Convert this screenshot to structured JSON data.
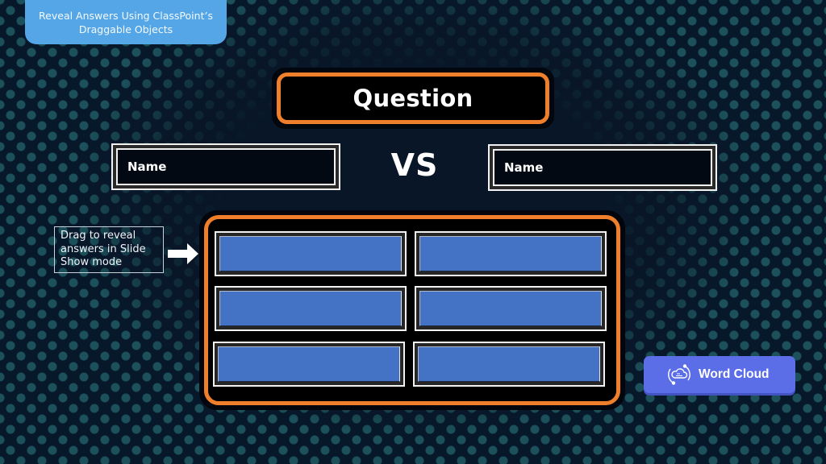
{
  "header": {
    "badge_line1": "Reveal Answers Using ClassPoint’s",
    "badge_line2": "Draggable Objects"
  },
  "slide": {
    "question_label": "Question",
    "vs_label": "VS",
    "left_name": "Name",
    "right_name": "Name",
    "hint_text": "Drag to reveal answers in Slide Show mode",
    "answer_tiles": [
      {
        "row": 1,
        "col": 1,
        "text": ""
      },
      {
        "row": 1,
        "col": 2,
        "text": ""
      },
      {
        "row": 2,
        "col": 1,
        "text": ""
      },
      {
        "row": 2,
        "col": 2,
        "text": ""
      },
      {
        "row": 3,
        "col": 1,
        "text": ""
      },
      {
        "row": 3,
        "col": 2,
        "text": ""
      }
    ]
  },
  "word_cloud_button": {
    "label": "Word Cloud",
    "icon": "word-cloud-icon"
  },
  "colors": {
    "accent_orange": "#ef7f2b",
    "tile_blue": "#4472c4",
    "badge_blue": "#55a6e6",
    "button_purple": "#5b6ee8",
    "background_navy": "#08182c",
    "dot_teal": "#1f5a63"
  }
}
